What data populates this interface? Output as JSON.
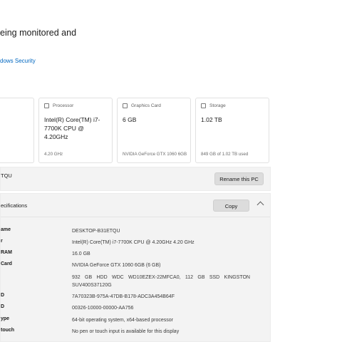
{
  "header": {
    "headline": "eing monitored and",
    "security_link": "dows Security"
  },
  "cards": [
    {
      "label": "",
      "value": "",
      "footer": ""
    },
    {
      "label": "Processor",
      "value": "Intel(R) Core(TM) i7-7700K CPU @ 4.20GHz",
      "footer": "4.20 GHz",
      "icon": "processor-icon"
    },
    {
      "label": "Graphics Card",
      "value": "6 GB",
      "footer": "NVIDIA GeForce GTX 1060 6GB",
      "icon": "graphics-card-icon"
    },
    {
      "label": "Storage",
      "value": "1.02 TB",
      "footer": "849 GB of 1.02 TB used",
      "icon": "storage-icon"
    }
  ],
  "device_name": {
    "text": "TQU",
    "rename_label": "Rename this PC"
  },
  "specs": {
    "title": "ecifications",
    "copy_label": "Copy",
    "rows": [
      {
        "label": "ame",
        "value": "DESKTOP-B31ETQU"
      },
      {
        "label": "r",
        "value": "Intel(R) Core(TM) i7-7700K CPU @ 4.20GHz   4.20 GHz"
      },
      {
        "label": "RAM",
        "value": "16.0 GB"
      },
      {
        "label": "Card",
        "value": "NVIDIA GeForce GTX 1060 6GB (6 GB)"
      },
      {
        "label": "",
        "value": "932 GB HDD WDC WD10EZEX-22MFCA0, 112 GB SSD KINGSTON SUV400S37120G"
      },
      {
        "label": "D",
        "value": "7A70323B-975A-47DB-B178-ADC3A454B64F"
      },
      {
        "label": "D",
        "value": "00326-10000-00000-AA756"
      },
      {
        "label": "ype",
        "value": "64-bit operating system, x64-based processor"
      },
      {
        "label": "touch",
        "value": "No pen or touch input is available for this display"
      }
    ]
  },
  "colors": {
    "link": "#0067c0",
    "panel": "#f3f3f3",
    "button": "#dcdcdc"
  }
}
